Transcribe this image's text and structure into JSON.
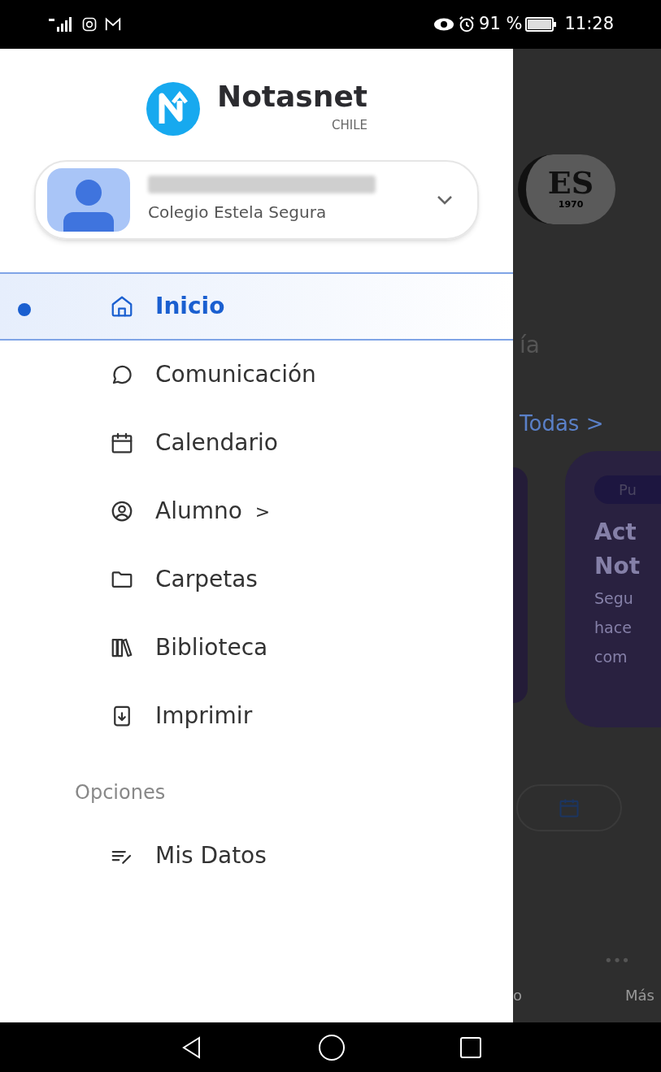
{
  "status_bar": {
    "battery": "91 %",
    "time": "11:28"
  },
  "drawer": {
    "brand": {
      "name": "Notasnet",
      "country": "CHILE"
    },
    "profile": {
      "school": "Colegio Estela Segura",
      "expanded": false
    },
    "menu": [
      {
        "label": "Inicio",
        "selected": true
      },
      {
        "label": "Comunicación",
        "selected": false
      },
      {
        "label": "Calendario",
        "selected": false
      },
      {
        "label": "Alumno",
        "suffix": ">",
        "selected": false
      },
      {
        "label": "Carpetas",
        "selected": false
      },
      {
        "label": "Biblioteca",
        "selected": false
      },
      {
        "label": "Imprimir",
        "selected": false
      }
    ],
    "section": "Opciones",
    "options": [
      {
        "label": "Mis Datos",
        "selected": false
      }
    ]
  },
  "background_screen": {
    "logo": {
      "initials": "ES",
      "year": "1970"
    },
    "heading": "ía",
    "link": "Todas >",
    "card": {
      "badge": "Pu",
      "title": [
        "Act",
        "Not"
      ],
      "text": [
        "Segu",
        "hace",
        "com"
      ]
    },
    "nav_more": "•••",
    "nav_labels": [
      "o",
      "Más"
    ]
  }
}
